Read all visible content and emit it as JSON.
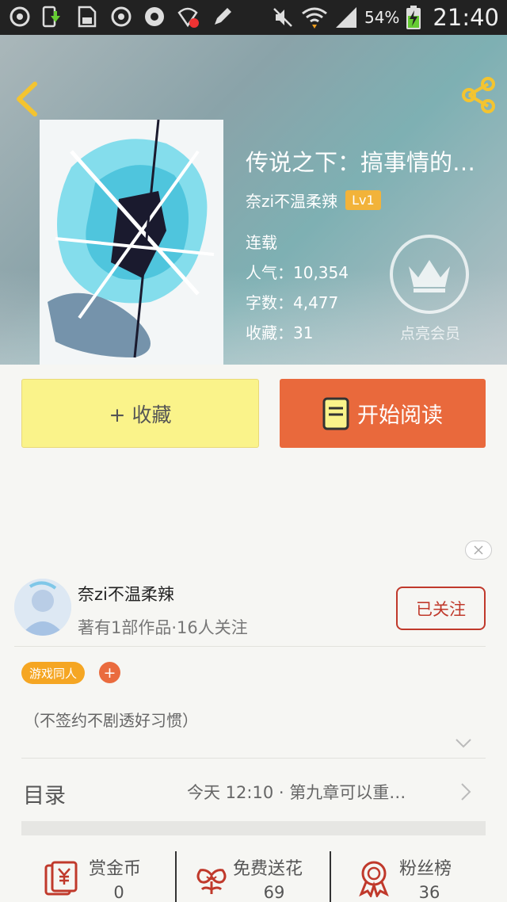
{
  "status_bar": {
    "battery_percent": "54%",
    "time": "21:40",
    "icons": [
      "chat-icon",
      "phone-upload-icon",
      "sd-card-icon",
      "chat-icon",
      "browser-icon",
      "shield-ad-icon",
      "pen-icon",
      "mute-icon",
      "wifi-icon",
      "signal-icon",
      "battery-charging-icon"
    ]
  },
  "book": {
    "title": "传说之下：搞事情的…",
    "author": "奈zi不温柔辣",
    "level": "Lv1",
    "status": "连载",
    "popularity": "人气：10,354",
    "word_count": "字数：4,477",
    "favorites": "收藏：31"
  },
  "member": {
    "label": "点亮会员"
  },
  "actions": {
    "collect_label": "+ 收藏",
    "read_label": "开始阅读"
  },
  "author_card": {
    "name": "奈zi不温柔辣",
    "subtitle": "著有1部作品·16人关注",
    "follow_label": "已关注"
  },
  "tags": [
    {
      "label": "游戏同人"
    }
  ],
  "tag_add_label": "+",
  "intro": "（不签约不剧透好习惯）",
  "toc": {
    "label": "目录",
    "latest": "今天 12:10 · 第九章可以重…"
  },
  "stats": [
    {
      "label": "赏金币",
      "value": "0",
      "icon": "reward-coin-icon"
    },
    {
      "label": "免费送花",
      "value": "69",
      "icon": "flower-icon"
    },
    {
      "label": "粉丝榜",
      "value": "36",
      "icon": "rank-medal-icon"
    }
  ],
  "colors": {
    "accent_orange": "#e9693c",
    "collect_yellow": "#faf38a",
    "follow_red": "#c0392b",
    "tag_orange": "#f5a623"
  }
}
